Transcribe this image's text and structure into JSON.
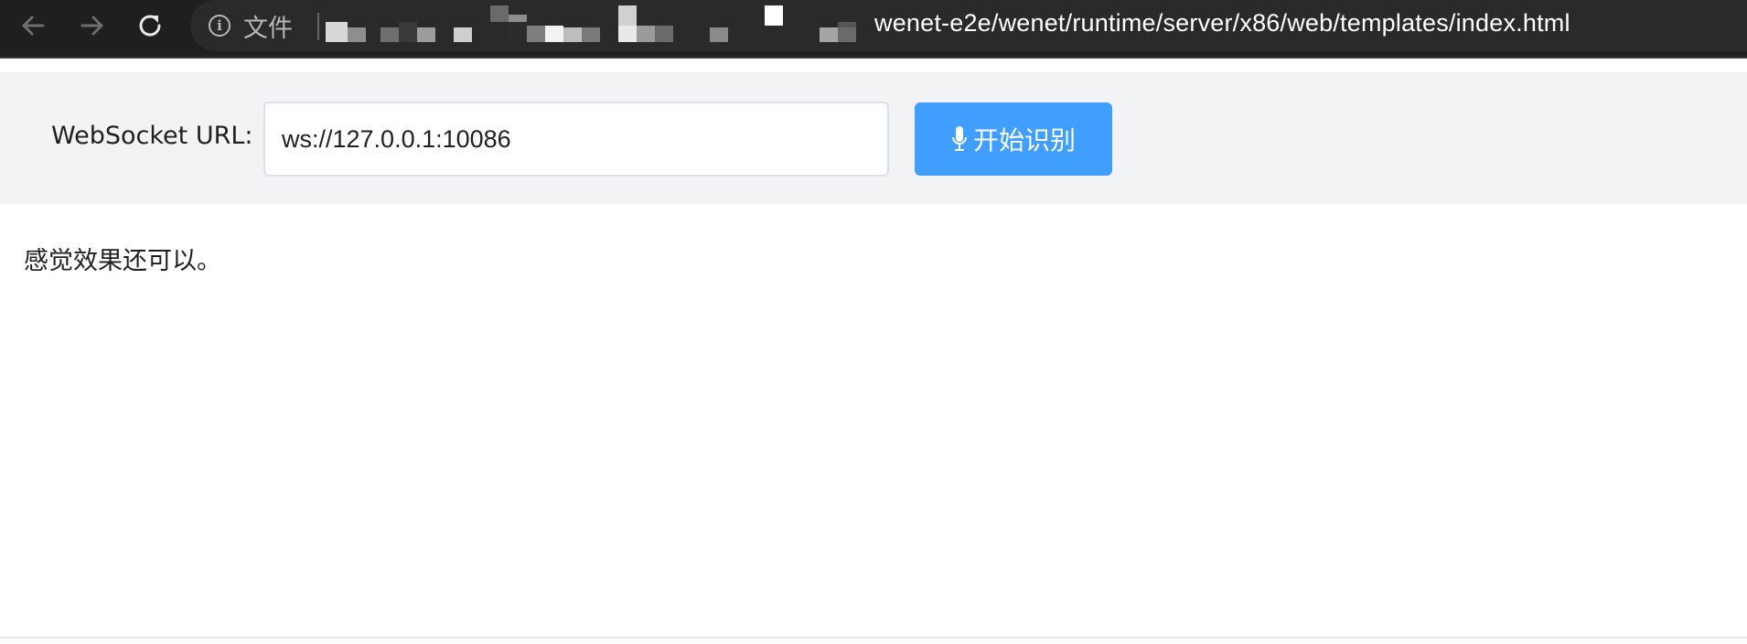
{
  "browser": {
    "back_icon": "arrow-left-icon",
    "forward_icon": "arrow-right-icon",
    "reload_icon": "reload-icon",
    "info_icon": "info-icon",
    "site_label": "文件",
    "url_visible": "wenet-e2e/wenet/runtime/server/x86/web/templates/index.html"
  },
  "form": {
    "ws_label": "WebSocket URL:",
    "ws_value": "ws://127.0.0.1:10086",
    "start_button_label": "开始识别",
    "button_icon": "microphone-icon",
    "button_color": "#409eff"
  },
  "result": {
    "text": "感觉效果还可以。"
  }
}
